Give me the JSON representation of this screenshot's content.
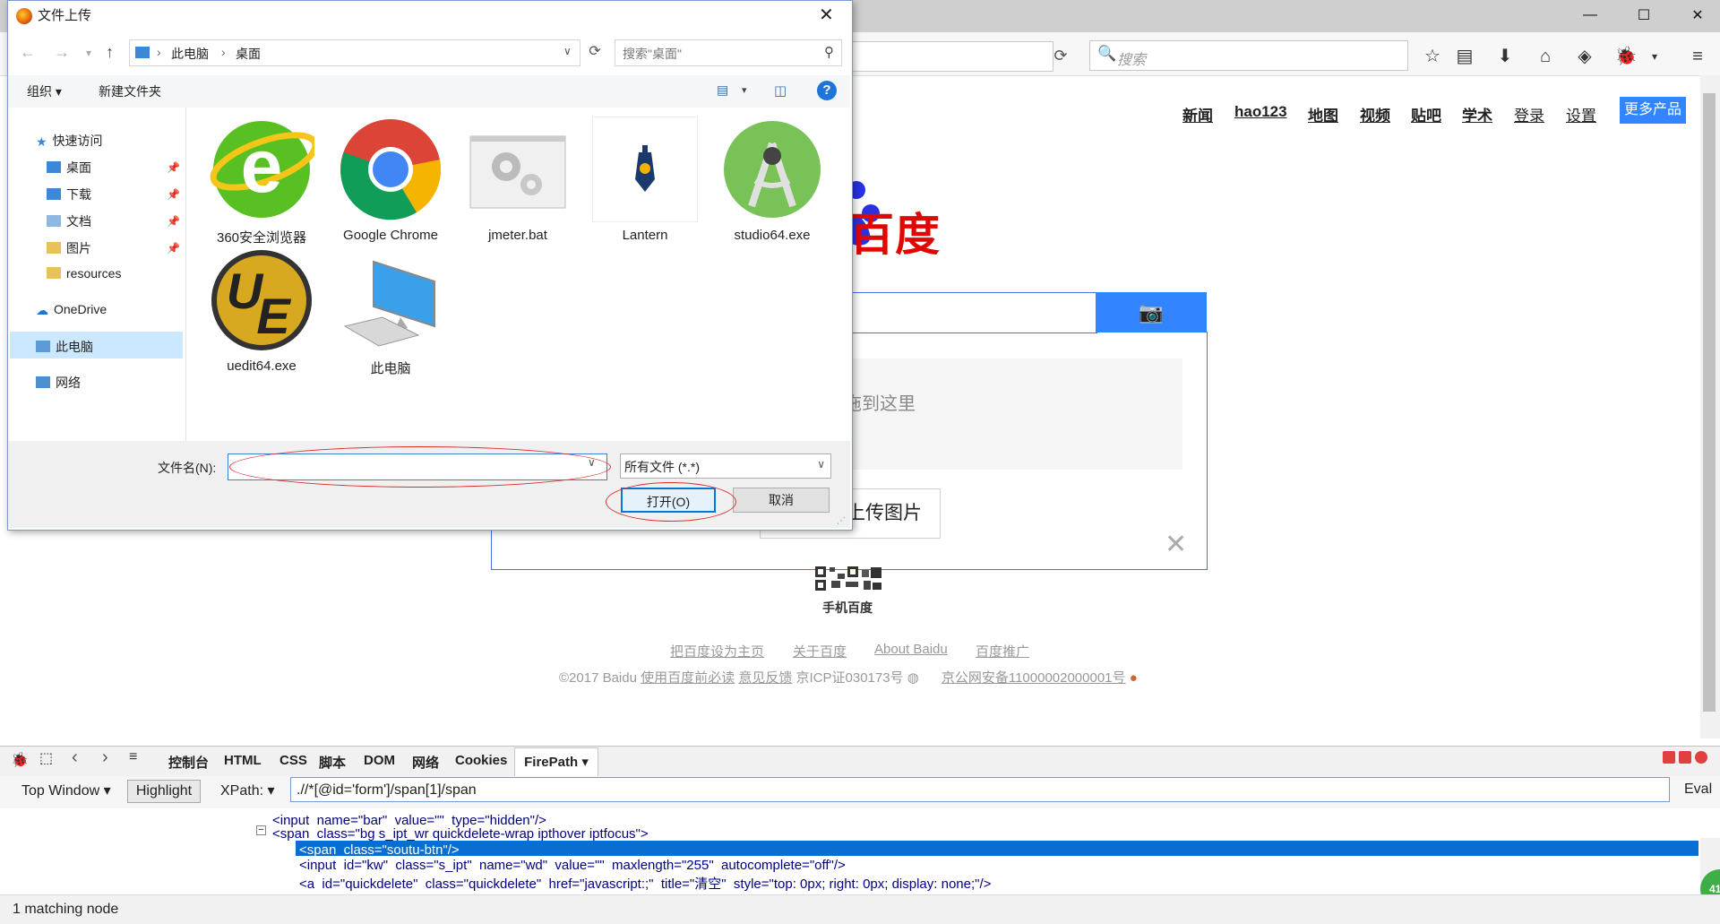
{
  "browser": {
    "search_placeholder": "搜索",
    "window_controls": {
      "minimize": "—",
      "maximize": "☐",
      "close": "✕"
    }
  },
  "baidu": {
    "nav": [
      "新闻",
      "hao123",
      "地图",
      "视频",
      "贴吧",
      "学术",
      "登录",
      "设置"
    ],
    "more_products": "更多产品",
    "logo_text": "百度",
    "drop_hint": "拖到这里",
    "upload_button": "上传图片",
    "mobile_label": "手机百度",
    "footer_links": [
      "把百度设为主页",
      "关于百度",
      "About Baidu",
      "百度推广"
    ],
    "copyright": "©2017 Baidu",
    "footer_link_terms": "使用百度前必读",
    "footer_link_feedback": "意见反馈",
    "icp": "京ICP证030173号",
    "police_record": "京公网安备11000002000001号"
  },
  "firebug": {
    "tabs": [
      "控制台",
      "HTML",
      "CSS",
      "脚本",
      "DOM",
      "网络",
      "Cookies"
    ],
    "active_tab": "FirePath",
    "top_window": "Top Window",
    "highlight": "Highlight",
    "xpath_label": "XPath:",
    "xpath_value": ".//*[@id='form']/span[1]/span",
    "eval": "Eval",
    "status": "1 matching node",
    "code_lines": [
      "<input  name=\"bar\"  value=\"\"  type=\"hidden\"/>",
      "<span  class=\"bg s_ipt_wr quickdelete-wrap ipthover iptfocus\">",
      "<span  class=\"soutu-btn\"/>",
      "<input  id=\"kw\"  class=\"s_ipt\"  name=\"wd\"  value=\"\"  maxlength=\"255\"  autocomplete=\"off\"/>",
      "<a  id=\"quickdelete\"  class=\"quickdelete\"  href=\"javascript:;\"  title=\"清空\"  style=\"top: 0px; right: 0px; display: none;\"/>"
    ],
    "badge": "41"
  },
  "dialog": {
    "title": "文件上传",
    "path": [
      "此电脑",
      "桌面"
    ],
    "search_placeholder": "搜索\"桌面\"",
    "organize": "组织 ▾",
    "new_folder": "新建文件夹",
    "help": "?",
    "nav": {
      "quick_access": "快速访问",
      "desktop": "桌面",
      "downloads": "下载",
      "documents": "文档",
      "pictures": "图片",
      "resources": "resources",
      "onedrive": "OneDrive",
      "this_pc": "此电脑",
      "network": "网络"
    },
    "files": [
      {
        "name": "360安全浏览器",
        "icon": "360-browser-icon"
      },
      {
        "name": "Google Chrome",
        "icon": "chrome-icon"
      },
      {
        "name": "jmeter.bat",
        "icon": "batch-file-icon"
      },
      {
        "name": "Lantern",
        "icon": "lantern-icon"
      },
      {
        "name": "studio64.exe",
        "icon": "android-studio-icon"
      },
      {
        "name": "uedit64.exe",
        "icon": "ultraedit-icon"
      },
      {
        "name": "此电脑",
        "icon": "computer-icon"
      }
    ],
    "filename_label": "文件名(N):",
    "filename_value": "",
    "filter": "所有文件 (*.*)",
    "open_button": "打开(O)",
    "cancel_button": "取消"
  }
}
